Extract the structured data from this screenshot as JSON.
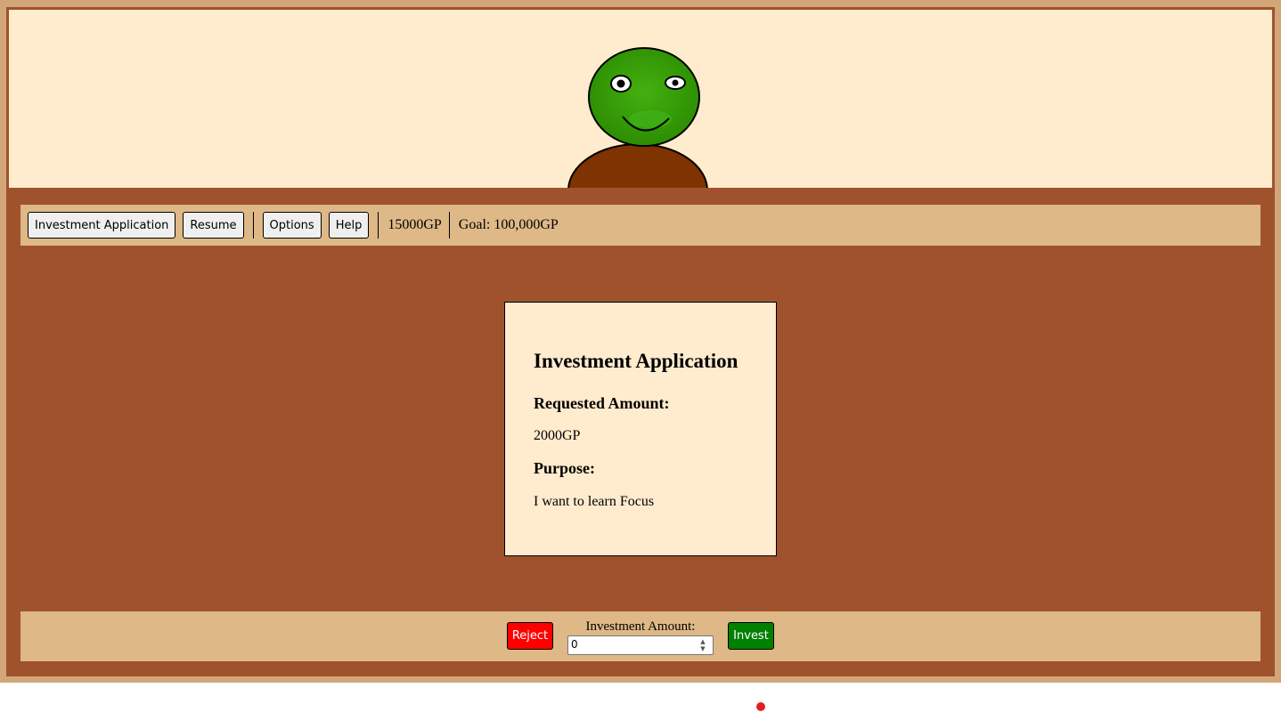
{
  "toolbar": {
    "investment_application_label": "Investment Application",
    "resume_label": "Resume",
    "options_label": "Options",
    "help_label": "Help",
    "gold": "15000GP",
    "goal": "Goal: 100,000GP"
  },
  "application": {
    "title": "Investment Application",
    "requested_amount_heading": "Requested Amount:",
    "requested_amount": "2000GP",
    "purpose_heading": "Purpose:",
    "purpose": "I want to learn Focus"
  },
  "actions": {
    "reject_label": "Reject",
    "invest_label": "Invest",
    "amount_label": "Investment Amount:",
    "amount_value": "0"
  },
  "colors": {
    "frame": "#d2a679",
    "table": "#a0522d",
    "panel": "#deb887",
    "card": "#ffebcd",
    "reject": "#ff0000",
    "invest": "#008000",
    "character_skin": "#33a000",
    "character_body": "#7f3300"
  },
  "icons": {
    "character": "green-frog-applicant",
    "cursor": "red-dot-cursor"
  }
}
